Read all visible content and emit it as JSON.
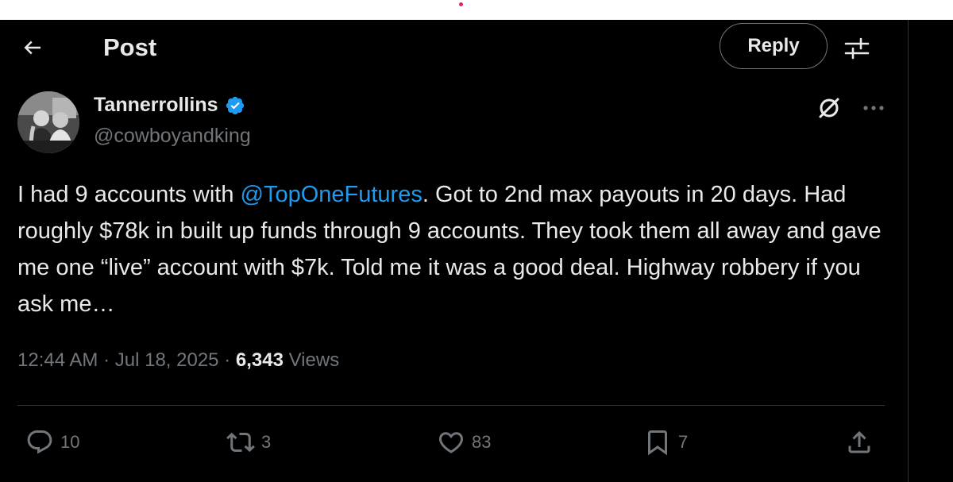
{
  "header": {
    "title": "Post",
    "reply_label": "Reply"
  },
  "post": {
    "author": {
      "display_name": "Tannerrollins",
      "handle": "@cowboyandking",
      "verified": true
    },
    "text_before_mention": "I had 9 accounts with ",
    "mention": "@TopOneFutures",
    "text_after_mention": ". Got to 2nd max payouts in 20 days. Had roughly $78k in built up funds through 9 accounts. They took them all away and gave me one “live” account with $7k. Told me it was a good deal. Highway robbery if you ask me…",
    "time": "12:44 AM",
    "date": "Jul 18, 2025",
    "views_count": "6,343",
    "views_label": "Views"
  },
  "actions": {
    "replies": "10",
    "reposts": "3",
    "likes": "83",
    "bookmarks": "7"
  },
  "icons": {
    "back": "back-arrow-icon",
    "filter": "sliders-icon",
    "verified": "verified-badge-icon",
    "grok": "grok-icon",
    "more": "more-icon",
    "reply": "reply-icon",
    "repost": "repost-icon",
    "like": "heart-icon",
    "bookmark": "bookmark-icon",
    "share": "share-icon"
  },
  "colors": {
    "background": "#000000",
    "text": "#e7e9ea",
    "muted": "#71767b",
    "accent": "#1d9bf0",
    "divider": "#2f3336"
  }
}
